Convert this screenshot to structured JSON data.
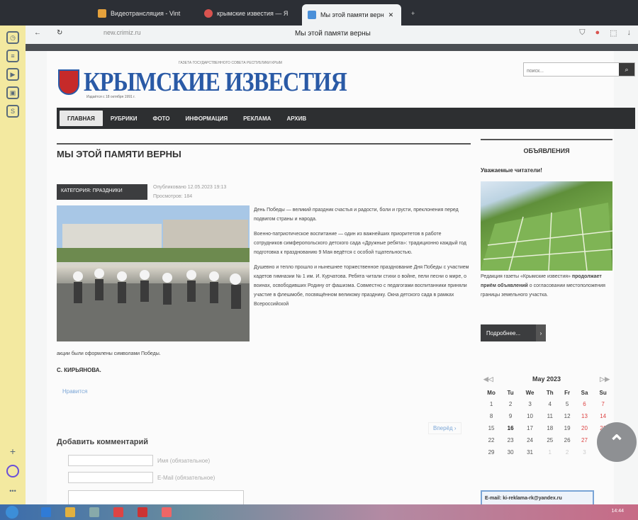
{
  "browser": {
    "tabs": [
      {
        "label": "Видеотрансляция - Vint",
        "color": "#e6a23c"
      },
      {
        "label": "крымские известия — Я",
        "color": "#d9534f"
      },
      {
        "label": "Мы этой памяти верн",
        "color": "#4a90d9"
      }
    ],
    "url": "new.crimiz.ru",
    "page_title": "Мы этой памяти верны"
  },
  "site": {
    "logo_small": "ГАЗЕТА ГОСУДАРСТВЕННОГО СОВЕТА РЕСПУБЛИКИ КРЫМ",
    "logo": "КРЫМСКИЕ ИЗВЕСТИЯ",
    "logo_sub": "Издаётся с 18 октября 1991 г.",
    "search_placeholder": "поиск...",
    "search_icon": "🔍",
    "nav": [
      "ГЛАВНАЯ",
      "РУБРИКИ",
      "ФОТО",
      "ИНФОРМАЦИЯ",
      "РЕКЛАМА",
      "АРХИВ"
    ]
  },
  "article": {
    "title": "МЫ ЭТОЙ ПАМЯТИ ВЕРНЫ",
    "category": "КАТЕГОРИЯ: ПРАЗДНИКИ",
    "published": "Опубликовано 12.05.2023 19:13",
    "views": "Просмотров: 184",
    "paragraphs": [
      "День Победы — великий праздник счастья и радости, боли и грусти, преклонения перед подвигом страны и народа.",
      "Военно-патриотическое воспитание — один из важнейших приоритетов в работе сотрудников симферопольского детского сада «Дружные ребята»: традиционно каждый год подготовка к празднованию 9 Мая ведётся с особой тщательностью.",
      "Душевно и тепло прошло и нынешнее торжественное празднование Дня Победы с участием кадетов гимназии № 1 им. И. Курчатова. Ребята читали стихи о войне, пели песни о мире, о воинах, освободивших Родину от фашизма. Совместно с педагогами воспитанники приняли участие в флешмобе, посвящённом великому празднику. Окна детского сада в рамках Всероссийской"
    ],
    "tail": "акции были оформлены символами Победы.",
    "author": "С. КИРЬЯНОВА.",
    "like": "Нравится",
    "next": "Вперёд ›"
  },
  "comments": {
    "title": "Добавить комментарий",
    "name_label": "Имя (обязательное)",
    "email_label": "E-Mail (обязательное)"
  },
  "sidebar_right": {
    "heading": "ОБЪЯВЛЕНИЯ",
    "subheading": "Уважаемые читатели!",
    "text_pre": "Редакция газеты «Крымские известия»",
    "text_bold": "продолжает приём объявлений",
    "text_post": "о согласовании местоположения границы земельного участка.",
    "more": "Подробнее...",
    "email": "E-mail: ki-reklama-rk@yandex.ru"
  },
  "calendar": {
    "month": "May 2023",
    "weekdays": [
      "Mo",
      "Tu",
      "We",
      "Th",
      "Fr",
      "Sa",
      "Su"
    ],
    "weeks": [
      [
        "1",
        "2",
        "3",
        "4",
        "5",
        "6",
        "7"
      ],
      [
        "8",
        "9",
        "10",
        "11",
        "12",
        "13",
        "14"
      ],
      [
        "15",
        "16",
        "17",
        "18",
        "19",
        "20",
        "21"
      ],
      [
        "22",
        "23",
        "24",
        "25",
        "26",
        "27",
        "28"
      ],
      [
        "29",
        "30",
        "31",
        "1",
        "2",
        "3",
        "4"
      ]
    ],
    "today": "16"
  },
  "taskbar": {
    "clock": "14:44"
  }
}
